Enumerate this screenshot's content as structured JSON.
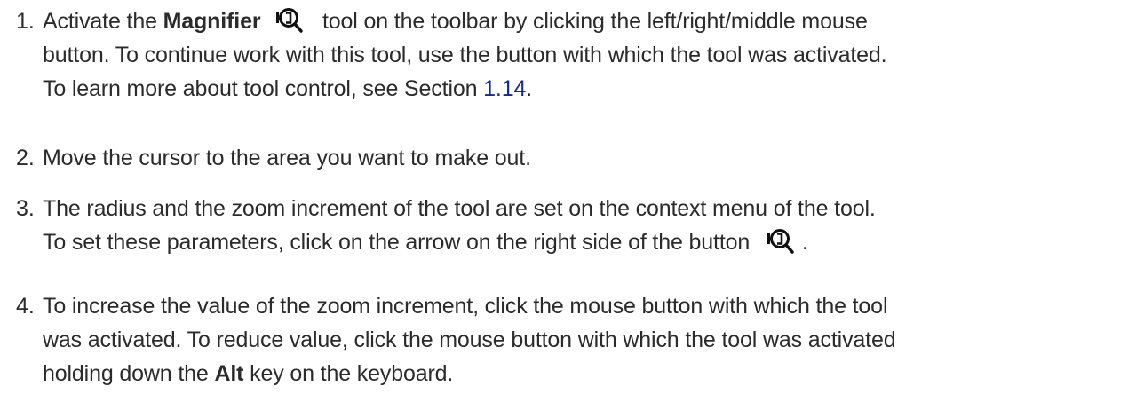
{
  "steps": [
    {
      "number": "1.",
      "lines": [
        {
          "a": "Activate the ",
          "bold": "Magnifier",
          "b": "tool on the toolbar by clicking the left/right/middle mouse"
        },
        "button.  To continue work with this tool, use the button with which the tool was activated.",
        {
          "a": "To learn more about tool control, see Section ",
          "link": "1.14",
          "b": "."
        }
      ]
    },
    {
      "number": "2.",
      "text": "Move the cursor to the area you want to make out."
    },
    {
      "number": "3.",
      "line1": "The radius and the zoom increment of the tool are set on the context menu of the tool.",
      "line2": "To set these parameters, click on the arrow on the right side of the button",
      "line2_end": "."
    },
    {
      "number": "4.",
      "line1": "To increase the value of the zoom increment, click the mouse button with which the tool",
      "line2": "was activated.  To reduce value, click the mouse button with which the tool was activated",
      "line3_a": "holding down the ",
      "line3_bold": "Alt",
      "line3_b": " key on the keyboard."
    }
  ],
  "icons": {
    "magnifier": "magnifier-icon"
  }
}
